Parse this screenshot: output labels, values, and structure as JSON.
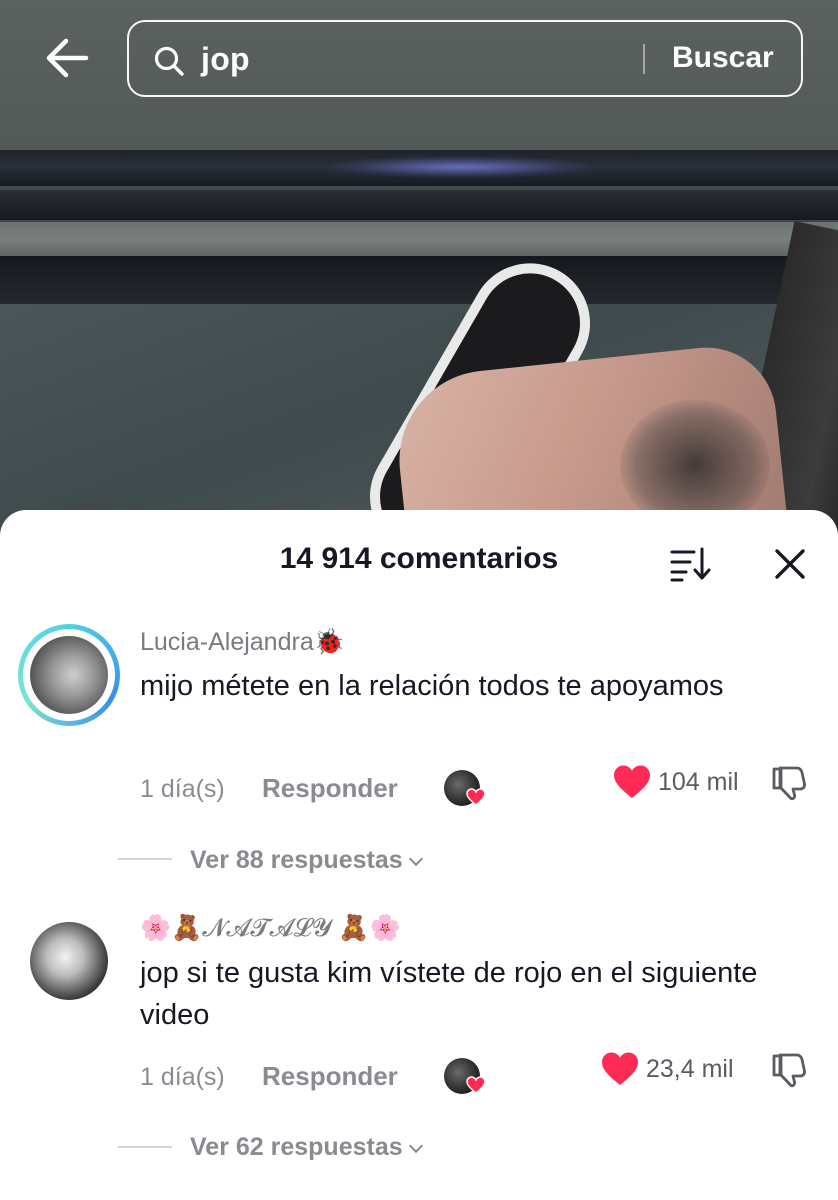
{
  "search": {
    "query": "jop",
    "submit_label": "Buscar"
  },
  "sheet": {
    "title": "14 914 comentarios"
  },
  "comments": [
    {
      "username": "Lucia-Alejandra🐞",
      "text": "mijo métete en la relación todos te apoyamos",
      "time": "1 día(s)",
      "reply_label": "Responder",
      "likes": "104 mil",
      "replies_label": "Ver 88 respuestas"
    },
    {
      "username": "🌸🧸𝓝𝓐𝓣𝓐𝓛𝓨 🧸🌸",
      "text": "jop si te gusta kim vístete de rojo en el siguiente video",
      "time": "1 día(s)",
      "reply_label": "Responder",
      "likes": "23,4 mil",
      "replies_label": "Ver 62 respuestas"
    }
  ],
  "colors": {
    "like_red": "#fe2c55",
    "text_dark": "#161823",
    "text_muted": "#8a8b91",
    "ring_cyan": "#4fd2e6"
  },
  "icons": [
    "back-arrow-icon",
    "search-icon",
    "sort-icon",
    "close-icon",
    "heart-icon",
    "dislike-icon",
    "chevron-down-icon"
  ]
}
